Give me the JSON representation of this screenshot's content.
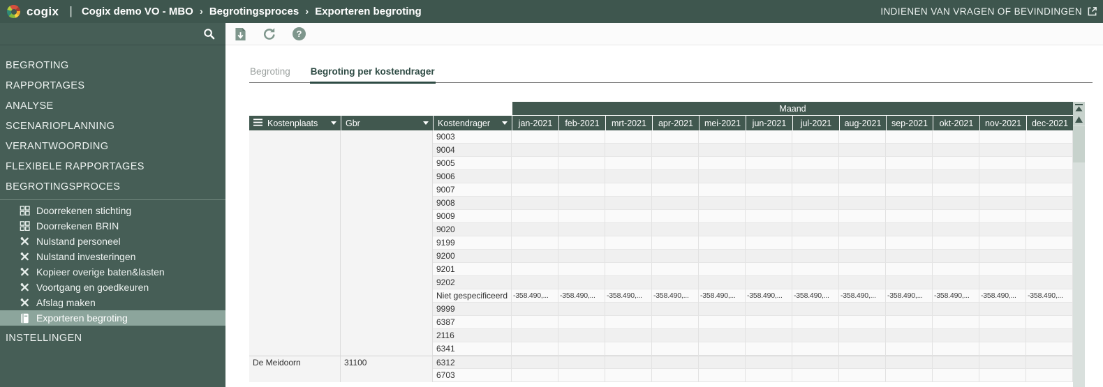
{
  "header": {
    "logo_text": "cogix",
    "separator": "|",
    "breadcrumb": [
      "Cogix demo VO - MBO",
      "Begrotingsproces",
      "Exporteren begroting"
    ],
    "crumb_sep": "›",
    "feedback_link": "INDIENEN VAN VRAGEN OF BEVINDINGEN"
  },
  "toolbar": {
    "help_glyph": "?",
    "icons": [
      "search-icon",
      "export-document-icon",
      "refresh-icon",
      "help-icon"
    ]
  },
  "sidebar": {
    "items": [
      "BEGROTING",
      "RAPPORTAGES",
      "ANALYSE",
      "SCENARIOPLANNING",
      "VERANTWOORDING",
      "FLEXIBELE RAPPORTAGES",
      "BEGROTINGSPROCES"
    ],
    "subitems": [
      {
        "icon": "grid-icon",
        "label": "Doorrekenen stichting",
        "selected": false
      },
      {
        "icon": "grid-icon",
        "label": "Doorrekenen BRIN",
        "selected": false
      },
      {
        "icon": "tools-icon",
        "label": "Nulstand personeel",
        "selected": false
      },
      {
        "icon": "tools-icon",
        "label": "Nulstand investeringen",
        "selected": false
      },
      {
        "icon": "tools-icon",
        "label": "Kopieer overige baten&lasten",
        "selected": false
      },
      {
        "icon": "tools-icon",
        "label": "Voortgang en goedkeuren",
        "selected": false
      },
      {
        "icon": "tools-icon",
        "label": "Afslag maken",
        "selected": false
      },
      {
        "icon": "book-icon",
        "label": "Exporteren begroting",
        "selected": true
      }
    ],
    "bottom_item": "INSTELLINGEN"
  },
  "tabs": [
    {
      "label": "Begroting",
      "active": false
    },
    {
      "label": "Begroting per kostendrager",
      "active": true
    }
  ],
  "table": {
    "group_header": "Maand",
    "columns": [
      "Kostenplaats",
      "Gbr",
      "Kostendrager"
    ],
    "months": [
      "jan-2021",
      "feb-2021",
      "mrt-2021",
      "apr-2021",
      "mei-2021",
      "jun-2021",
      "jul-2021",
      "aug-2021",
      "sep-2021",
      "okt-2021",
      "nov-2021",
      "dec-2021"
    ],
    "rows": [
      {
        "kostenplaats": "",
        "gbr": "",
        "kostendrager": "9003",
        "month_values": null
      },
      {
        "kostenplaats": "",
        "gbr": "",
        "kostendrager": "9004",
        "month_values": null
      },
      {
        "kostenplaats": "",
        "gbr": "",
        "kostendrager": "9005",
        "month_values": null
      },
      {
        "kostenplaats": "",
        "gbr": "",
        "kostendrager": "9006",
        "month_values": null
      },
      {
        "kostenplaats": "",
        "gbr": "",
        "kostendrager": "9007",
        "month_values": null
      },
      {
        "kostenplaats": "",
        "gbr": "",
        "kostendrager": "9008",
        "month_values": null
      },
      {
        "kostenplaats": "",
        "gbr": "",
        "kostendrager": "9009",
        "month_values": null
      },
      {
        "kostenplaats": "",
        "gbr": "",
        "kostendrager": "9020",
        "month_values": null
      },
      {
        "kostenplaats": "",
        "gbr": "",
        "kostendrager": "9199",
        "month_values": null
      },
      {
        "kostenplaats": "",
        "gbr": "",
        "kostendrager": "9200",
        "month_values": null
      },
      {
        "kostenplaats": "",
        "gbr": "",
        "kostendrager": "9201",
        "month_values": null
      },
      {
        "kostenplaats": "",
        "gbr": "",
        "kostendrager": "9202",
        "month_values": null
      },
      {
        "kostenplaats": "",
        "gbr": "",
        "kostendrager": "Niet gespecificeerd",
        "month_values": "-358.490,..."
      },
      {
        "kostenplaats": "",
        "gbr": "",
        "kostendrager": "9999",
        "month_values": null
      },
      {
        "kostenplaats": "",
        "gbr": "",
        "kostendrager": "6387",
        "month_values": null
      },
      {
        "kostenplaats": "",
        "gbr": "",
        "kostendrager": "2116",
        "month_values": null
      },
      {
        "kostenplaats": "",
        "gbr": "",
        "kostendrager": "6341",
        "month_values": null
      },
      {
        "kostenplaats": "De Meidoorn",
        "gbr": "31100",
        "kostendrager": "6312",
        "month_values": null,
        "group_start": true
      },
      {
        "kostenplaats": "",
        "gbr": "",
        "kostendrager": "6703",
        "month_values": null,
        "partial": true
      }
    ]
  },
  "colors": {
    "header_bg": "#3E564E",
    "sidebar_bg": "#465E56",
    "selected_bg": "#8CA59C",
    "accent": "#2E4B44",
    "icon_muted": "#7E968C",
    "table_header_bg": "#41584F",
    "row_even": "#fafafa",
    "row_odd": "#f0f0f0",
    "scroll_track": "#d9e0dd",
    "scroll_thumb": "#c7d2cc"
  }
}
